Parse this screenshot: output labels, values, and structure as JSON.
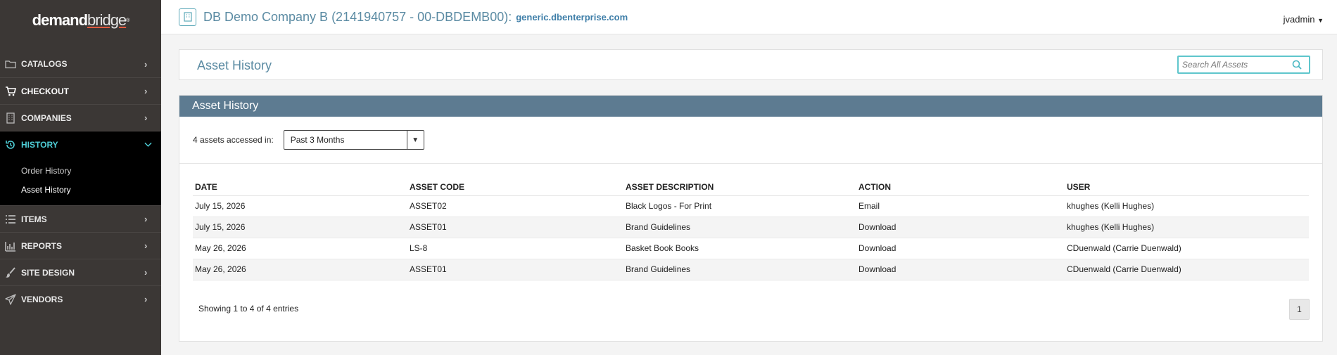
{
  "sidebar": {
    "logo_part1": "demand",
    "logo_part2": "bridge",
    "logo_mark": "®",
    "items": [
      {
        "label": "CATALOGS",
        "icon": "folder-icon"
      },
      {
        "label": "CHECKOUT",
        "icon": "cart-icon"
      },
      {
        "label": "COMPANIES",
        "icon": "building-icon"
      },
      {
        "label": "HISTORY",
        "icon": "history-icon",
        "expanded": true
      },
      {
        "label": "ITEMS",
        "icon": "list-icon"
      },
      {
        "label": "REPORTS",
        "icon": "bar-chart-icon"
      },
      {
        "label": "SITE DESIGN",
        "icon": "brush-icon"
      },
      {
        "label": "VENDORS",
        "icon": "paper-plane-icon"
      }
    ],
    "history_sub": [
      "Order History",
      "Asset History"
    ]
  },
  "header": {
    "company_title": "DB Demo Company B (2141940757 - 00-DBDEMB00):",
    "company_domain": "generic.dbenterprise.com",
    "user": "jvadmin"
  },
  "title_panel": {
    "title": "Asset History",
    "search_placeholder": "Search All Assets"
  },
  "card": {
    "heading": "Asset History",
    "filter_label": "4 assets accessed in:",
    "filter_value": "Past 3 Months",
    "columns": [
      "DATE",
      "ASSET CODE",
      "ASSET DESCRIPTION",
      "ACTION",
      "USER"
    ],
    "rows": [
      [
        "July 15, 2026",
        "ASSET02",
        "Black Logos - For Print",
        "Email",
        "khughes (Kelli Hughes)"
      ],
      [
        "July 15, 2026",
        "ASSET01",
        "Brand Guidelines",
        "Download",
        "khughes (Kelli Hughes)"
      ],
      [
        "May 26, 2026",
        "LS-8",
        "Basket Book Books",
        "Download",
        "CDuenwald (Carrie Duenwald)"
      ],
      [
        "May 26, 2026",
        "ASSET01",
        "Brand Guidelines",
        "Download",
        "CDuenwald (Carrie Duenwald)"
      ]
    ],
    "info": "Showing 1 to 4 of 4 entries",
    "page": "1"
  },
  "colors": {
    "sidebar_bg": "#3b3735",
    "accent": "#4ecdd6",
    "card_header": "#5d7b91",
    "title_text": "#5b8ba3"
  }
}
